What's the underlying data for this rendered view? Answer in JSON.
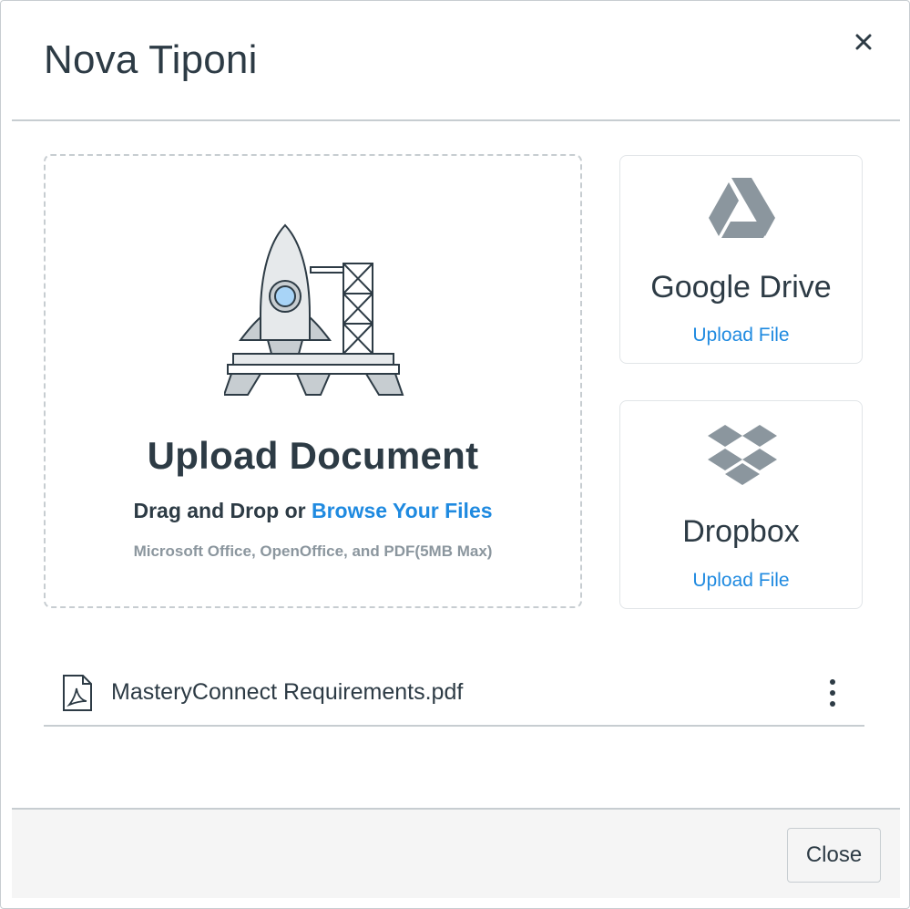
{
  "modal": {
    "title": "Nova Tiponi"
  },
  "dropzone": {
    "heading": "Upload Document",
    "drag_text": "Drag and Drop or ",
    "browse_link": "Browse Your Files",
    "formats": "Microsoft Office, OpenOffice, and PDF(5MB Max)"
  },
  "services": [
    {
      "name": "Google Drive",
      "link": "Upload File",
      "icon": "google-drive-icon"
    },
    {
      "name": "Dropbox",
      "link": "Upload File",
      "icon": "dropbox-icon"
    }
  ],
  "files": [
    {
      "name": "MasteryConnect Requirements.pdf",
      "icon": "pdf-file-icon"
    }
  ],
  "footer": {
    "close_label": "Close"
  },
  "colors": {
    "text": "#2d3b45",
    "link": "#1f8ae0",
    "muted": "#8b969e",
    "border": "#c7cdd1",
    "icon_gray": "#8b969e"
  }
}
